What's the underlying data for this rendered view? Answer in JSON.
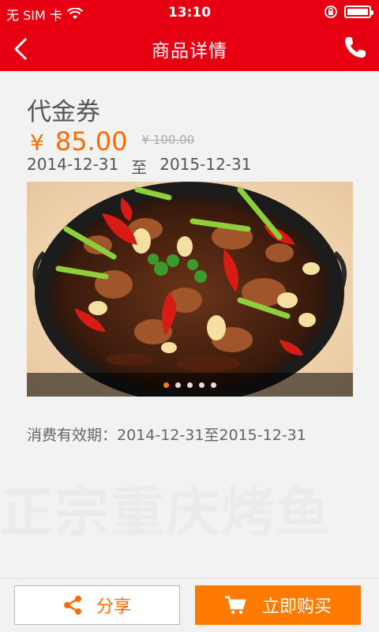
{
  "status_bar": {
    "carrier": "无 SIM 卡",
    "time": "13:10",
    "icons": [
      "wifi-icon",
      "rotation-lock-icon",
      "battery-icon"
    ]
  },
  "nav": {
    "title": "商品详情",
    "back_icon": "chevron-left-icon",
    "phone_icon": "phone-icon"
  },
  "product": {
    "title": "代金券",
    "currency": "¥",
    "price": "85.00",
    "original_price": "¥ 100.00",
    "start_date": "2014-12-31",
    "date_separator": "至",
    "end_date": "2015-12-31",
    "validity": "消费有效期：2014-12-31至2015-12-31"
  },
  "banner": {
    "total_slides": 5,
    "active_slide": 0
  },
  "watermark_text": "正宗重庆烤鱼",
  "actions": {
    "share_label": "分享",
    "buy_label": "立即购买"
  },
  "colors": {
    "primary_red": "#e60012",
    "accent_orange": "#ff7a00"
  }
}
